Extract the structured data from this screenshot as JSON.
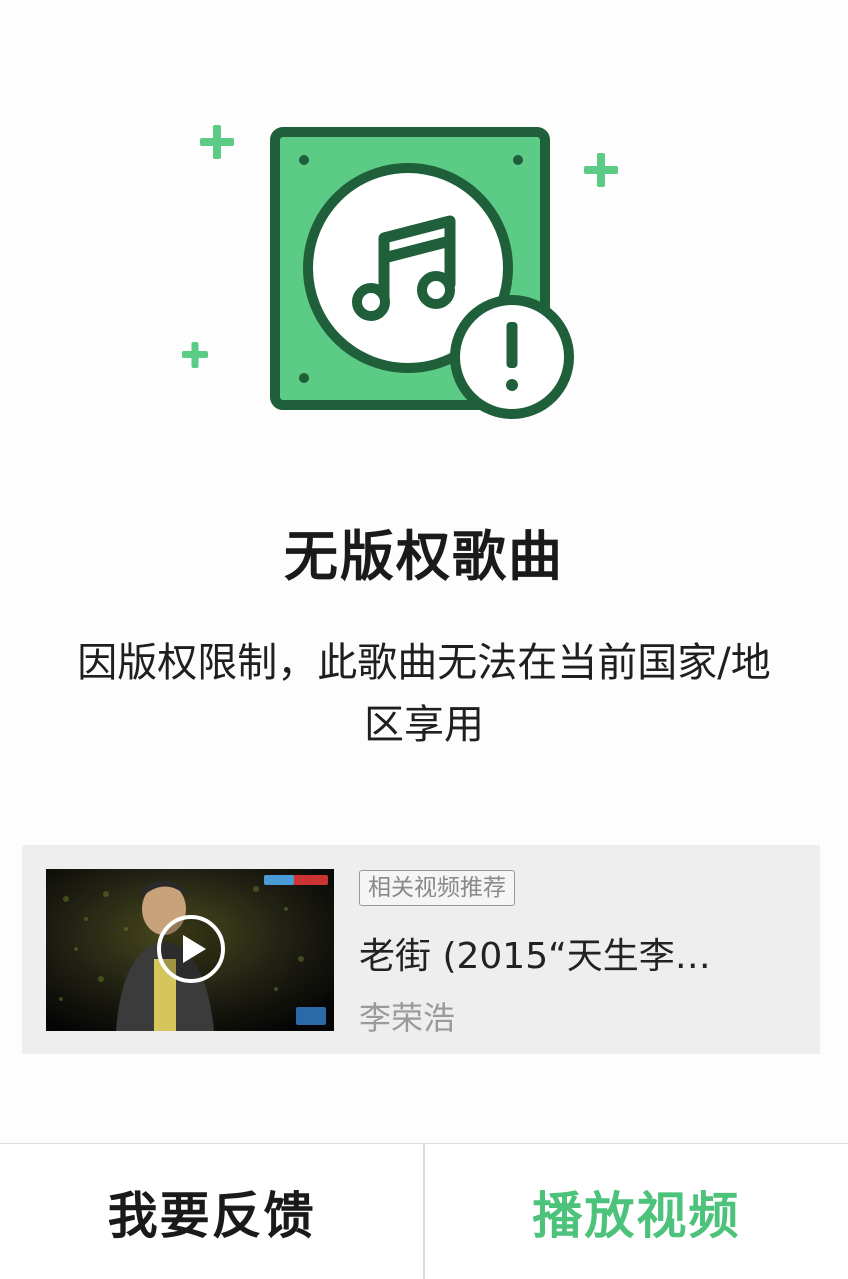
{
  "colors": {
    "accent": "#4cc27a",
    "icon_fill": "#5ccb86",
    "icon_stroke": "#1f5f3a"
  },
  "hero": {
    "icon": "music-copyright-warning-icon"
  },
  "title": "无版权歌曲",
  "message": "因版权限制，此歌曲无法在当前国家/地区享用",
  "related": {
    "tag": "相关视频推荐",
    "video_title": "老街 (2015“天生李…",
    "artist": "李荣浩",
    "thumbnail_icon": "play-icon"
  },
  "actions": {
    "feedback_label": "我要反馈",
    "play_video_label": "播放视频"
  }
}
